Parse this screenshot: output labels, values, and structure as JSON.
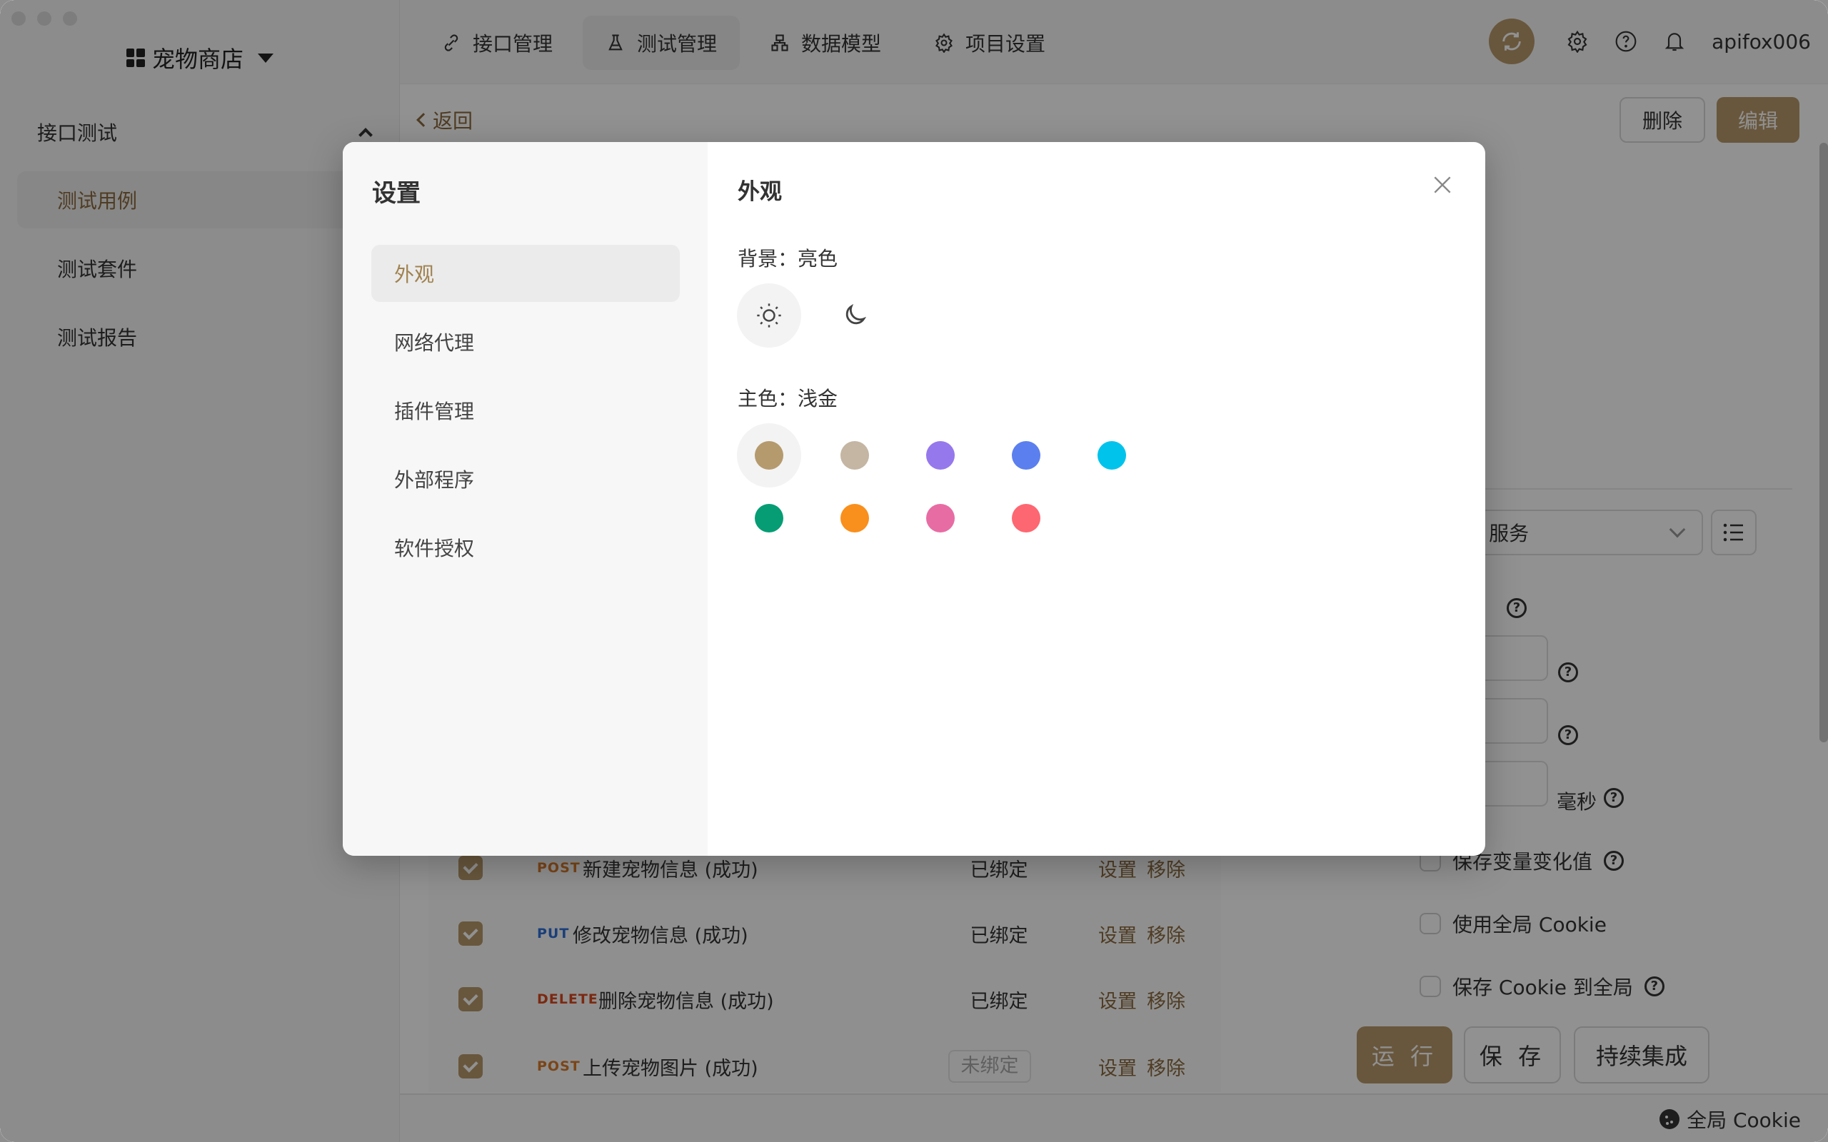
{
  "window": {
    "traffic_lights": [
      "close",
      "minimize",
      "maximize"
    ]
  },
  "sidebar": {
    "project_name": "宠物商店",
    "project_icon": "grid-icon",
    "group_label": "接口测试",
    "items": [
      {
        "label": "测试用例",
        "active": true
      },
      {
        "label": "测试套件",
        "active": false
      },
      {
        "label": "测试报告",
        "active": false
      }
    ]
  },
  "topbar": {
    "tabs": [
      {
        "label": "接口管理",
        "icon": "link-icon",
        "active": false
      },
      {
        "label": "测试管理",
        "icon": "flask-icon",
        "active": true
      },
      {
        "label": "数据模型",
        "icon": "sitemap-icon",
        "active": false
      },
      {
        "label": "项目设置",
        "icon": "gear-icon",
        "active": false
      }
    ],
    "username": "apifox006"
  },
  "main": {
    "back_label": "返回",
    "delete_label": "删除",
    "edit_label": "编辑",
    "rows": [
      {
        "method": "POST",
        "method_color": "#d97a2b",
        "name": "新建宠物信息 (成功)",
        "bind": "已绑定",
        "bound": true,
        "actions": [
          "设置",
          "移除"
        ]
      },
      {
        "method": "PUT",
        "method_color": "#2f6fd6",
        "name": "修改宠物信息 (成功)",
        "bind": "已绑定",
        "bound": true,
        "actions": [
          "设置",
          "移除"
        ]
      },
      {
        "method": "DELETE",
        "method_color": "#d9481f",
        "name": "删除宠物信息 (成功)",
        "bind": "已绑定",
        "bound": true,
        "actions": [
          "设置",
          "移除"
        ]
      },
      {
        "method": "POST",
        "method_color": "#d97a2b",
        "name": "上传宠物图片 (成功)",
        "bind": "未绑定",
        "bound": false,
        "actions": [
          "设置",
          "移除"
        ]
      }
    ],
    "right_panel": {
      "environment_value_partial": "k 服务",
      "timeout_unit": "毫秒",
      "checkboxes": [
        {
          "label": "保存变量变化值",
          "checked": false,
          "help": true
        },
        {
          "label": "使用全局 Cookie",
          "checked": false,
          "help": false
        },
        {
          "label": "保存 Cookie 到全局",
          "checked": false,
          "help": true
        }
      ],
      "run_label": "运 行",
      "save_label": "保 存",
      "ci_label": "持续集成"
    }
  },
  "statusbar": {
    "cookie_label": "全局 Cookie"
  },
  "modal": {
    "title": "设置",
    "nav": [
      {
        "label": "外观",
        "active": true
      },
      {
        "label": "网络代理",
        "active": false
      },
      {
        "label": "插件管理",
        "active": false
      },
      {
        "label": "外部程序",
        "active": false
      },
      {
        "label": "软件授权",
        "active": false
      }
    ],
    "section_title": "外观",
    "background_label": "背景：亮色",
    "background_options": [
      {
        "name": "light",
        "icon": "sun-icon",
        "selected": true
      },
      {
        "name": "dark",
        "icon": "moon-icon",
        "selected": false
      }
    ],
    "primary_label": "主色：浅金",
    "colors": [
      {
        "name": "浅金",
        "hex": "#b59a6d",
        "selected": true
      },
      {
        "hex": "#c4b6a3",
        "selected": false
      },
      {
        "hex": "#9578ec",
        "selected": false
      },
      {
        "hex": "#5b7fee",
        "selected": false
      },
      {
        "hex": "#00c3ec",
        "selected": false
      },
      {
        "hex": "#069d74",
        "selected": false
      },
      {
        "hex": "#f98f1c",
        "selected": false
      },
      {
        "hex": "#e86ca4",
        "selected": false
      },
      {
        "hex": "#fd6771",
        "selected": false
      }
    ]
  }
}
